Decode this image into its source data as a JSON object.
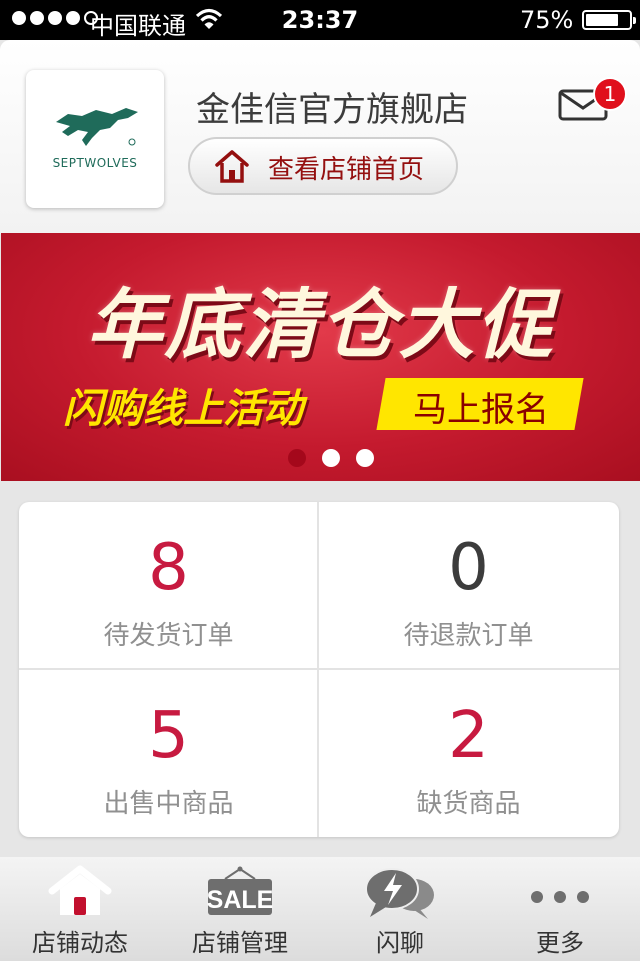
{
  "status_bar": {
    "carrier": "中国联通",
    "time": "23:37",
    "battery_percent": "75%",
    "battery_level": 0.75,
    "signal_bars": 4
  },
  "header": {
    "logo_text": "SEPTWOLVES",
    "store_name": "金佳信官方旗舰店",
    "home_button_label": "查看店铺首页",
    "message_badge_count": "1",
    "colors": {
      "store_name": "#3C3C3C",
      "home_button_label": "#940F0F",
      "badge_text": "#FFFFFF"
    }
  },
  "banner": {
    "headline": "年底清仓大促",
    "subline": "闪购线上活动",
    "cta_label": "马上报名",
    "page_count": 3,
    "active_page": 0
  },
  "stats": {
    "items": [
      {
        "value": "8",
        "label": "待发货订单",
        "value_color": "#C71A40"
      },
      {
        "value": "0",
        "label": "待退款订单",
        "value_color": "#3C3C3C"
      },
      {
        "value": "5",
        "label": "出售中商品",
        "value_color": "#C71A40"
      },
      {
        "value": "2",
        "label": "缺货商品",
        "value_color": "#C71A40"
      }
    ],
    "label_color": "#909090"
  },
  "tab_bar": {
    "tabs": [
      {
        "label": "店铺动态",
        "icon": "home-icon",
        "active": true
      },
      {
        "label": "店铺管理",
        "icon": "sale-tag-icon",
        "active": false
      },
      {
        "label": "闪聊",
        "icon": "chat-bubbles-icon",
        "active": false
      },
      {
        "label": "更多",
        "icon": "more-dots-icon",
        "active": false
      }
    ],
    "sale_icon_text": "SALE",
    "active_color": "#C2102E"
  }
}
